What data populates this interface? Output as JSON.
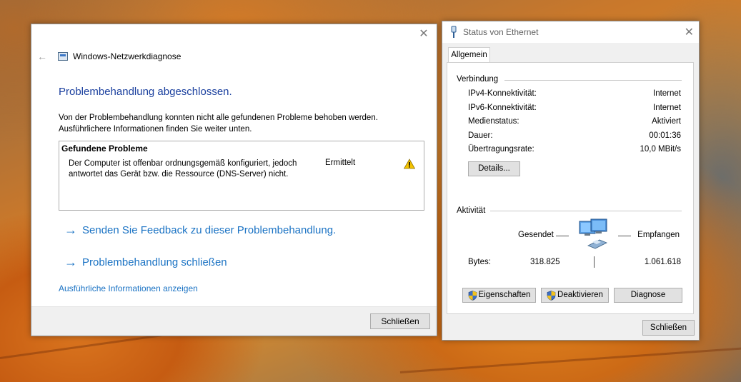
{
  "diagnose_window": {
    "close_glyph": "✕",
    "title": "Windows-Netzwerkdiagnose",
    "heading": "Problembehandlung abgeschlossen.",
    "description_line1": "Von der Problembehandlung konnten nicht alle gefundenen Probleme behoben werden.",
    "description_line2": "Ausführlichere Informationen finden Sie weiter unten.",
    "problems_header": "Gefundene Probleme",
    "problem_text": "Der Computer ist offenbar ordnungsgemäß konfiguriert, jedoch antwortet das Gerät bzw. die Ressource (DNS-Server) nicht.",
    "problem_status": "Ermittelt",
    "problem_icon": "warning-icon",
    "link_feedback": "Senden Sie Feedback zu dieser Problembehandlung.",
    "link_close": "Problembehandlung schließen",
    "link_details": "Ausführliche Informationen anzeigen",
    "close_button": "Schließen"
  },
  "ethernet_window": {
    "title": "Status von Ethernet",
    "close_glyph": "✕",
    "tab": "Allgemein",
    "connection_group": "Verbindung",
    "rows": [
      {
        "label": "IPv4-Konnektivität:",
        "value": "Internet"
      },
      {
        "label": "IPv6-Konnektivität:",
        "value": "Internet"
      },
      {
        "label": "Medienstatus:",
        "value": "Aktiviert"
      },
      {
        "label": "Dauer:",
        "value": "00:01:36"
      },
      {
        "label": "Übertragungsrate:",
        "value": "10,0 MBit/s"
      }
    ],
    "details_button": "Details...",
    "activity_group": "Aktivität",
    "sent_label": "Gesendet",
    "received_label": "Empfangen",
    "bytes_label": "Bytes:",
    "bytes_sent": "318.825",
    "bytes_received": "1.061.618",
    "properties_button": "Eigenschaften",
    "disable_button": "Deaktivieren",
    "diagnose_button": "Diagnose",
    "close_button": "Schließen"
  },
  "colors": {
    "link_blue": "#1b73c4",
    "heading_blue": "#1a3f9e",
    "warning_yellow": "#f5c400"
  }
}
